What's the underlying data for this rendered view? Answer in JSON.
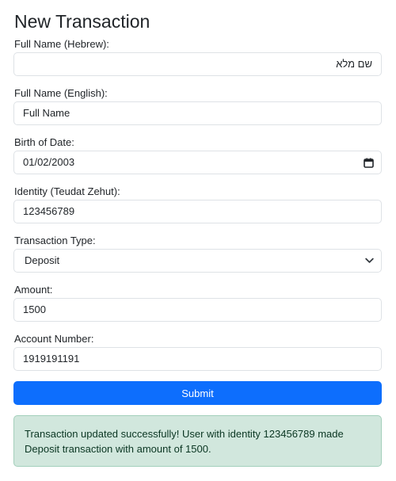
{
  "page": {
    "title": "New Transaction"
  },
  "form": {
    "hebrew_name": {
      "label": "Full Name (Hebrew):",
      "placeholder": "שם מלא"
    },
    "english_name": {
      "label": "Full Name (English):",
      "placeholder": "Full Name"
    },
    "birth_date": {
      "label": "Birth of Date:",
      "value": "01/02/2003",
      "icon": "calendar-icon"
    },
    "identity": {
      "label": "Identity (Teudat Zehut):",
      "value": "123456789"
    },
    "transaction_type": {
      "label": "Transaction Type:",
      "value": "Deposit",
      "icon": "chevron-down-icon"
    },
    "amount": {
      "label": "Amount:",
      "value": "1500"
    },
    "account_number": {
      "label": "Account Number:",
      "value": "1919191191"
    },
    "submit_label": "Submit"
  },
  "alert": {
    "message": "Transaction updated successfully! User with identity 123456789 made Deposit transaction with amount of 1500."
  },
  "colors": {
    "primary": "#0d6efd",
    "success_bg": "#d1e7dd",
    "success_border": "#a3cfbb",
    "success_text": "#0a3622",
    "input_border": "#dee2e6",
    "text": "#212529"
  }
}
